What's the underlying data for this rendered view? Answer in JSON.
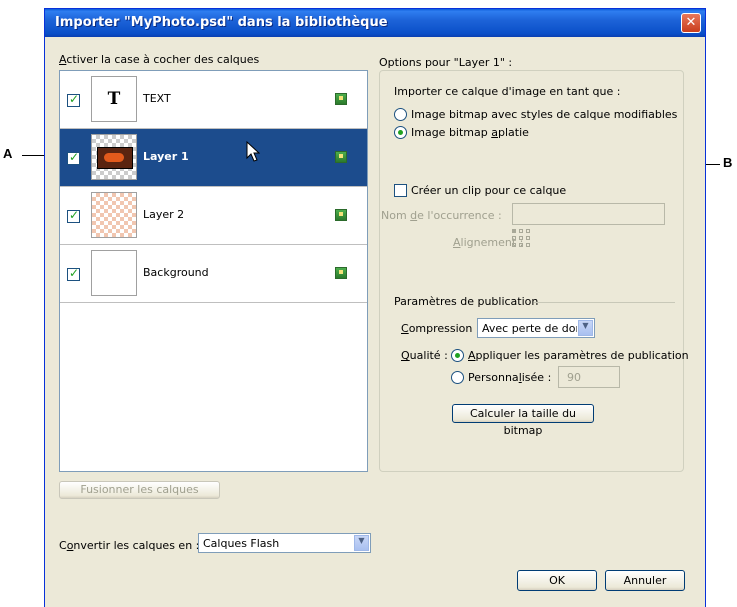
{
  "callouts": {
    "a": "A",
    "b": "B"
  },
  "dialog": {
    "title": "Importer \"MyPhoto.psd\" dans la bibliothèque",
    "close_glyph": "✕"
  },
  "left_panel": {
    "list_label_key": "A",
    "list_label_rest": "ctiver la case à cocher des calques",
    "layers": [
      {
        "name": "TEXT",
        "thumbnail": "T",
        "checked": true,
        "selected": false
      },
      {
        "name": "Layer 1",
        "checked": true,
        "selected": true
      },
      {
        "name": "Layer 2",
        "checked": true,
        "selected": false
      },
      {
        "name": "Background",
        "checked": true,
        "selected": false
      }
    ],
    "merge_button": "Fusionner les calques",
    "convert_label_pre": "C",
    "convert_label_key": "o",
    "convert_label_post": "nvertir les calques en :",
    "convert_value": "Calques Flash"
  },
  "right_panel": {
    "options_title": "Options pour \"Layer 1\" :",
    "import_as_label": "Importer ce calque d'image en tant que :",
    "radio_editable": "Image bitmap avec styles de calque modifiables",
    "radio_flat_pre": "Image bitmap ",
    "radio_flat_key": "a",
    "radio_flat_post": "platie",
    "clip_checkbox": "Créer un clip pour ce calque",
    "instance_name_pre": "Nom ",
    "instance_name_key": "d",
    "instance_name_post": "e l'occurrence :",
    "alignment_key": "A",
    "alignment_rest": "lignement :",
    "publish_group": "Paramètres de publication",
    "compression_key": "C",
    "compression_rest": "ompression :",
    "compression_value": "Avec perte de doni",
    "quality_key": "Q",
    "quality_rest": "ualité :",
    "quality_publish_key": "A",
    "quality_publish_rest": "ppliquer les paramètres de publication",
    "quality_custom_pre": "Personna",
    "quality_custom_key": "l",
    "quality_custom_post": "isée :",
    "quality_custom_value": "90",
    "calc_button": "Calculer la taille du bitmap"
  },
  "footer": {
    "ok": "OK",
    "cancel": "Annuler"
  },
  "colors": {
    "title_bar": "#1d63d8",
    "selection": "#1c4c8d",
    "dialog_bg": "#ece9d8"
  }
}
